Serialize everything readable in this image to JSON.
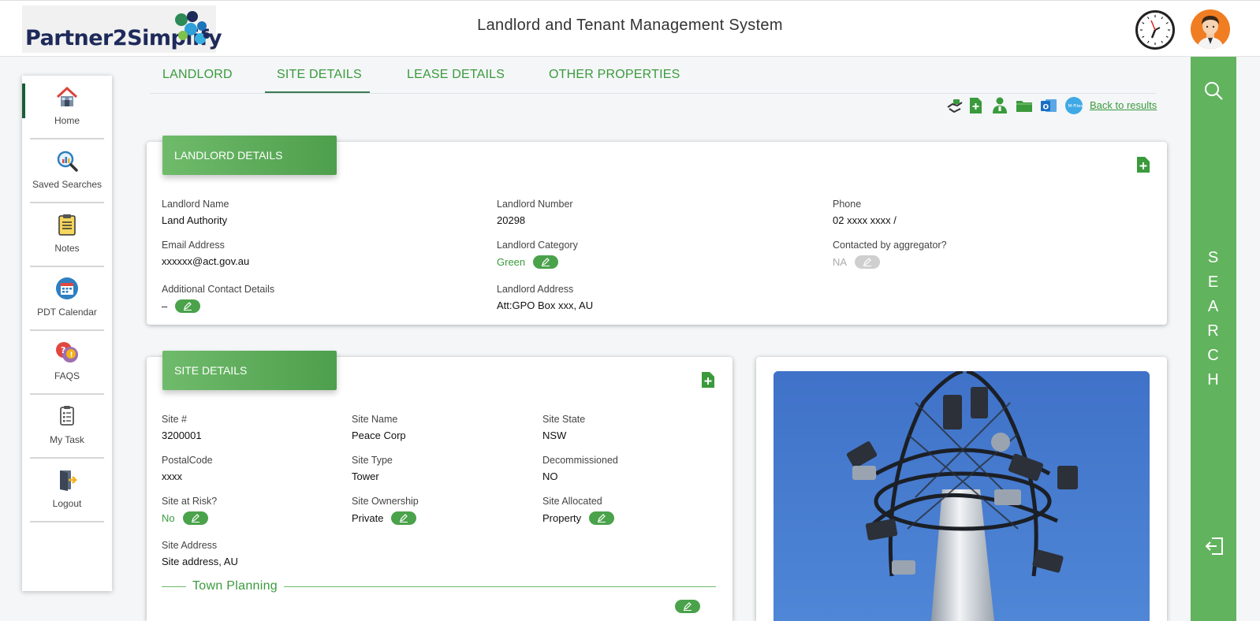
{
  "header": {
    "logo_text": "Partner2Simplify",
    "title": "Landlord and Tenant Management System"
  },
  "sidebar": {
    "items": [
      {
        "label": "Home",
        "icon": "home-icon"
      },
      {
        "label": "Saved Searches",
        "icon": "saved-search-icon"
      },
      {
        "label": "Notes",
        "icon": "notes-icon"
      },
      {
        "label": "PDT Calendar",
        "icon": "calendar-icon"
      },
      {
        "label": "FAQS",
        "icon": "faq-icon"
      },
      {
        "label": "My Task",
        "icon": "task-icon"
      },
      {
        "label": "Logout",
        "icon": "logout-icon"
      }
    ]
  },
  "tabs": [
    "LANDLORD",
    "SITE DETAILS",
    "LEASE DETAILS",
    "OTHER PROPERTIES"
  ],
  "active_tab": "SITE DETAILS",
  "toolbar": {
    "back_link": "Back to results"
  },
  "right_rail": {
    "letters": [
      "S",
      "E",
      "A",
      "R",
      "C",
      "H"
    ]
  },
  "landlord_card": {
    "title": "LANDLORD DETAILS",
    "fields": {
      "name": {
        "label": "Landlord Name",
        "value": "Land Authority"
      },
      "number": {
        "label": "Landlord Number",
        "value": "20298"
      },
      "phone": {
        "label": "Phone",
        "value": "02 xxxx xxxx /"
      },
      "email": {
        "label": "Email Address",
        "value": "xxxxxx@act.gov.au"
      },
      "category": {
        "label": "Landlord Category",
        "value": "Green"
      },
      "aggregator": {
        "label": "Contacted by aggregator?",
        "value": "NA"
      },
      "additional": {
        "label": "Additional Contact Details",
        "value": "–"
      },
      "address": {
        "label": "Landlord Address",
        "value": "Att:GPO Box xxx, AU"
      }
    }
  },
  "site_card": {
    "title": "SITE DETAILS",
    "fields": {
      "site_no": {
        "label": "Site #",
        "value": "3200001"
      },
      "site_name": {
        "label": "Site Name",
        "value": "Peace Corp"
      },
      "site_state": {
        "label": "Site State",
        "value": "NSW"
      },
      "postal": {
        "label": "PostalCode",
        "value": "xxxx"
      },
      "site_type": {
        "label": "Site Type",
        "value": "Tower"
      },
      "decommissioned": {
        "label": "Decommissioned",
        "value": "NO"
      },
      "at_risk": {
        "label": "Site at Risk?",
        "value": "No"
      },
      "ownership": {
        "label": "Site Ownership",
        "value": "Private"
      },
      "allocated": {
        "label": "Site Allocated",
        "value": "Property"
      },
      "address": {
        "label": "Site Address",
        "value": "Site address, AU"
      }
    },
    "section_title": "Town Planning"
  },
  "colors": {
    "accent_green": "#3a9a3c",
    "rail_green": "#62b35e",
    "header_gradient_start": "#6fbb6b",
    "header_gradient_end": "#4e9f4d",
    "logo_navy": "#1e2a5a"
  }
}
